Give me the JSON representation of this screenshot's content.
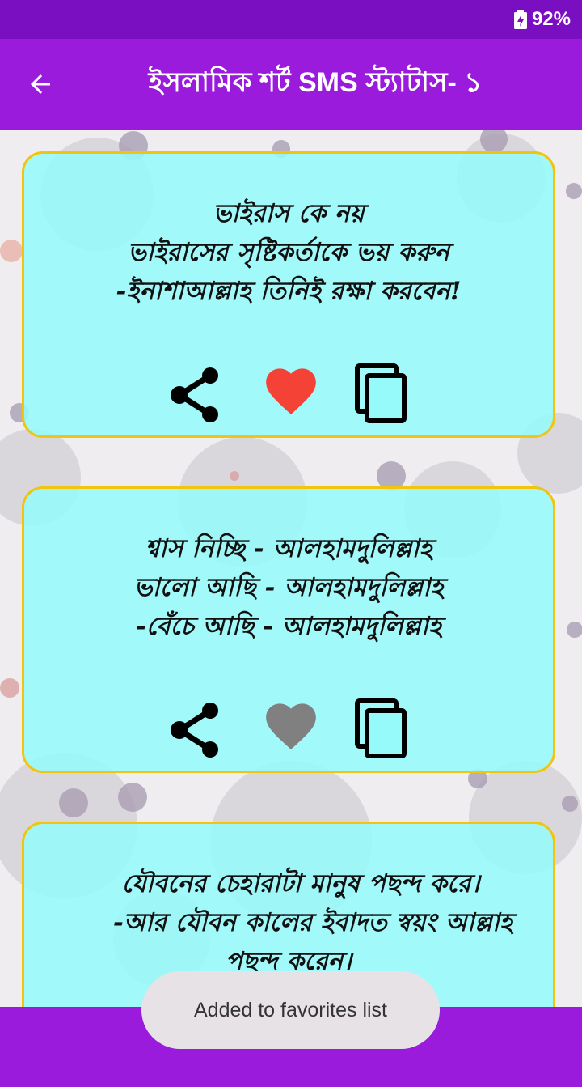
{
  "status_bar": {
    "battery_text": "92%",
    "battery_icon": "battery-charging-icon"
  },
  "app_bar": {
    "title": "ইসলামিক শর্ট SMS স্ট্যাটাস- ১",
    "back_icon": "arrow-back-icon"
  },
  "colors": {
    "status_bar": "#7a0fc2",
    "app_bar": "#9a1bdc",
    "card_bg": "#9ffafa",
    "card_border": "#f1c40f",
    "heart_active": "#f44336",
    "heart_inactive": "#808080"
  },
  "cards": [
    {
      "lines": [
        "ভাইরাস কে নয়",
        "ভাইরাসের সৃষ্টিকর্তাকে ভয় করুন",
        "-ইনাশাআল্লাহ তিনিই রক্ষা করবেন!"
      ],
      "favorited": true
    },
    {
      "lines": [
        "শ্বাস নিচ্ছি - আলহামদুলিল্লাহ",
        "ভালো আছি - আলহামদুলিল্লাহ",
        "-বেঁচে আছি - আলহামদুলিল্লাহ"
      ],
      "favorited": false
    },
    {
      "lines": [
        "যৌবনের চেহারাটা মানুষ পছন্দ করে।",
        "-আর যৌবন কালের ইবাদত স্বয়ং আল্লাহ",
        "পছন্দ করেন।"
      ],
      "favorited": false
    }
  ],
  "actions": {
    "share_icon": "share-icon",
    "favorite_icon": "heart-icon",
    "copy_icon": "copy-icon"
  },
  "toast": {
    "message": "Added to favorites list"
  }
}
